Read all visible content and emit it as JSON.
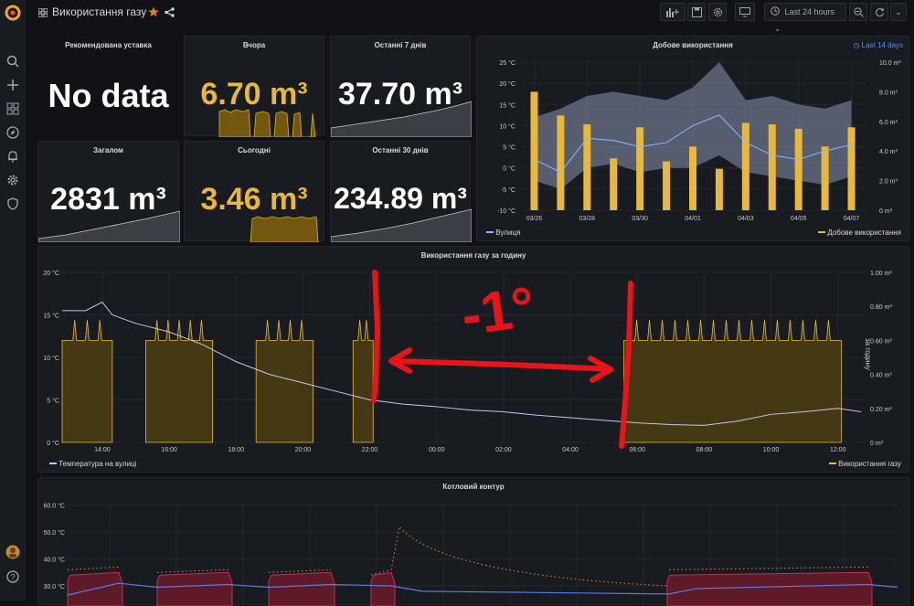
{
  "header": {
    "title": "Використання газу",
    "time_range": "Last 24 hours"
  },
  "stats": {
    "recommended": {
      "title": "Рекомендована уставка",
      "value": "No data"
    },
    "yesterday": {
      "title": "Вчора",
      "value": "6.70 m³"
    },
    "last7": {
      "title": "Останні 7 днів",
      "value": "37.70 m³"
    },
    "total": {
      "title": "Загалом",
      "value": "2831 m³"
    },
    "today": {
      "title": "Сьогодні",
      "value": "3.46 m³"
    },
    "last30": {
      "title": "Останні 30 днів",
      "value": "234.89 m³"
    }
  },
  "daily": {
    "title": "Добове використання",
    "badge": "Last 14 days",
    "legend_left": "Вулиця",
    "legend_right": "Добове використання"
  },
  "hourly": {
    "title": "Використання газу за годину",
    "legend_left": "Температура на вулиці",
    "legend_right": "Використання газу",
    "right_axis_label": "за годину",
    "annotation": "-1°"
  },
  "boiler": {
    "title": "Котловий контур"
  },
  "chart_data": [
    {
      "type": "bar",
      "title": "Добове використання",
      "categories": [
        "03/26",
        "03/27",
        "03/28",
        "03/29",
        "03/30",
        "03/31",
        "04/01",
        "04/02",
        "04/03",
        "04/04",
        "04/05",
        "04/06",
        "04/07"
      ],
      "series": [
        {
          "name": "Добове використання",
          "values": [
            8.0,
            6.4,
            5.8,
            3.5,
            5.6,
            3.3,
            4.3,
            2.8,
            5.9,
            5.8,
            5.5,
            4.3,
            5.6
          ]
        },
        {
          "name": "Вулиця",
          "values": [
            2,
            -1,
            7,
            6.5,
            5,
            6,
            10,
            12.5,
            6,
            3,
            2,
            4,
            5.5
          ]
        }
      ],
      "y_left_ticks": [
        "-10 °C",
        "-5 °C",
        "0 °C",
        "5 °C",
        "10 °C",
        "15 °C",
        "20 °C",
        "25 °C"
      ],
      "y_right_ticks": [
        "0 m³",
        "2.0 m³",
        "4.0 m³",
        "6.0 m³",
        "8.0 m³",
        "10.0 m³"
      ],
      "x_ticks": [
        "03/26",
        "03/28",
        "03/30",
        "04/01",
        "04/03",
        "04/05",
        "04/07"
      ]
    },
    {
      "type": "line",
      "title": "Використання газу за годину",
      "x_ticks": [
        "14:00",
        "16:00",
        "18:00",
        "20:00",
        "22:00",
        "00:00",
        "02:00",
        "04:00",
        "06:00",
        "08:00",
        "10:00",
        "12:00"
      ],
      "y_left_ticks": [
        "0 °C",
        "5 °C",
        "10 °C",
        "15 °C",
        "20 °C"
      ],
      "y_right_ticks": [
        "0 m³",
        "0.20 m³",
        "0.40 m³",
        "0.60 m³",
        "0.80 m³",
        "1.00 m³"
      ],
      "series": [
        {
          "name": "Температура на вулиці",
          "x": [
            12.8,
            13.5,
            14.0,
            14.3,
            15,
            16,
            17,
            18,
            19,
            20,
            21,
            22,
            23,
            0,
            1,
            2,
            3,
            4,
            5,
            6,
            7,
            8,
            9,
            10,
            11,
            12,
            12.8
          ],
          "values": [
            15.5,
            15.5,
            16.5,
            15,
            14,
            13,
            11.5,
            9.5,
            8,
            7,
            6,
            5,
            4.5,
            4.2,
            3.8,
            3.6,
            3.2,
            2.9,
            2.6,
            2.3,
            2.1,
            2.0,
            2.5,
            3.3,
            3.6,
            4.0,
            3.6
          ]
        }
      ]
    },
    {
      "type": "line",
      "title": "Котловий контур",
      "y_ticks": [
        "30.0 °C",
        "40.0 °C",
        "50.0 °C",
        "60.0 °C"
      ]
    }
  ]
}
